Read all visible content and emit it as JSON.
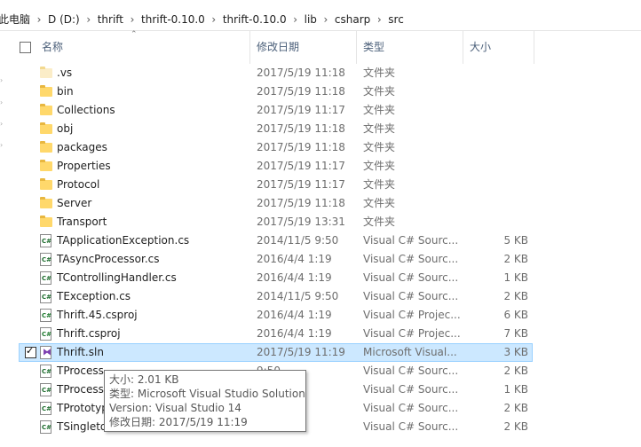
{
  "breadcrumb": [
    "此电脑",
    "D (D:)",
    "thrift",
    "thrift-0.10.0",
    "thrift-0.10.0",
    "lib",
    "csharp",
    "src"
  ],
  "columns": {
    "name": "名称",
    "date": "修改日期",
    "type": "类型",
    "size": "大小"
  },
  "icons": {
    "folder": "folder-icon",
    "cs": "csharp-file-icon",
    "csproj": "csharp-project-icon",
    "sln": "visual-studio-solution-icon"
  },
  "colors": {
    "selection_bg": "#cce8ff",
    "selection_border": "#99d1ff",
    "folder": "#ffd86b"
  },
  "rows": [
    {
      "name": ".vs",
      "date": "2017/5/19 11:18",
      "type": "文件夹",
      "size": "",
      "kind": "folder-pale"
    },
    {
      "name": "bin",
      "date": "2017/5/19 11:18",
      "type": "文件夹",
      "size": "",
      "kind": "folder"
    },
    {
      "name": "Collections",
      "date": "2017/5/19 11:17",
      "type": "文件夹",
      "size": "",
      "kind": "folder"
    },
    {
      "name": "obj",
      "date": "2017/5/19 11:18",
      "type": "文件夹",
      "size": "",
      "kind": "folder"
    },
    {
      "name": "packages",
      "date": "2017/5/19 11:18",
      "type": "文件夹",
      "size": "",
      "kind": "folder"
    },
    {
      "name": "Properties",
      "date": "2017/5/19 11:17",
      "type": "文件夹",
      "size": "",
      "kind": "folder"
    },
    {
      "name": "Protocol",
      "date": "2017/5/19 11:17",
      "type": "文件夹",
      "size": "",
      "kind": "folder"
    },
    {
      "name": "Server",
      "date": "2017/5/19 11:18",
      "type": "文件夹",
      "size": "",
      "kind": "folder"
    },
    {
      "name": "Transport",
      "date": "2017/5/19 13:31",
      "type": "文件夹",
      "size": "",
      "kind": "folder"
    },
    {
      "name": "TApplicationException.cs",
      "date": "2014/11/5 9:50",
      "type": "Visual C# Sourc...",
      "size": "5 KB",
      "kind": "cs"
    },
    {
      "name": "TAsyncProcessor.cs",
      "date": "2016/4/4 1:19",
      "type": "Visual C# Sourc...",
      "size": "2 KB",
      "kind": "cs"
    },
    {
      "name": "TControllingHandler.cs",
      "date": "2016/4/4 1:19",
      "type": "Visual C# Sourc...",
      "size": "1 KB",
      "kind": "cs"
    },
    {
      "name": "TException.cs",
      "date": "2014/11/5 9:50",
      "type": "Visual C# Sourc...",
      "size": "2 KB",
      "kind": "cs"
    },
    {
      "name": "Thrift.45.csproj",
      "date": "2016/4/4 1:19",
      "type": "Visual C# Projec...",
      "size": "6 KB",
      "kind": "csproj"
    },
    {
      "name": "Thrift.csproj",
      "date": "2016/4/4 1:19",
      "type": "Visual C# Projec...",
      "size": "7 KB",
      "kind": "csproj"
    },
    {
      "name": "Thrift.sln",
      "date": "2017/5/19 11:19",
      "type": "Microsoft Visual...",
      "size": "3 KB",
      "kind": "sln",
      "selected": true
    },
    {
      "name": "TProcess",
      "date": "9:50",
      "type": "Visual C# Sourc...",
      "size": "2 KB",
      "kind": "cs"
    },
    {
      "name": "TProcess",
      "date": "19",
      "type": "Visual C# Sourc...",
      "size": "1 KB",
      "kind": "cs"
    },
    {
      "name": "TPrototyp",
      "date": "19",
      "type": "Visual C# Sourc...",
      "size": "2 KB",
      "kind": "cs"
    },
    {
      "name": "TSingleto",
      "date": "19",
      "type": "Visual C# Sourc...",
      "size": "2 KB",
      "kind": "cs"
    }
  ],
  "tooltip": {
    "line1": "大小: 2.01 KB",
    "line2": "类型: Microsoft Visual Studio Solution",
    "line3": "Version: Visual Studio 14",
    "line4": "修改日期: 2017/5/19 11:19"
  }
}
